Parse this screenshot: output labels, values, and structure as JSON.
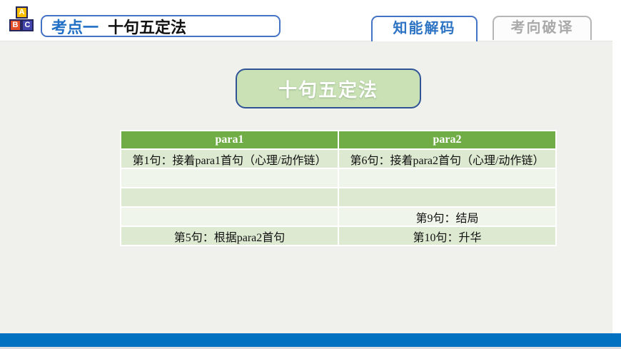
{
  "header": {
    "logo": {
      "blocks": [
        {
          "letter": "A",
          "color": "#ffc000"
        },
        {
          "letter": "B",
          "color": "#e44d26"
        },
        {
          "letter": "C",
          "color": "#4345ac"
        }
      ]
    },
    "badge": {
      "prefix": "考点一",
      "title": "十句五定法"
    },
    "tabs": [
      {
        "label": "知能解码",
        "active": true
      },
      {
        "label": "考向破译",
        "active": false
      }
    ]
  },
  "main": {
    "flow_button": "十句五定法",
    "table": {
      "columns": [
        "para1",
        "para2"
      ],
      "rows": [
        [
          "第1句：接着para1首句（心理/动作链）",
          "第6句：接着para2首句（心理/动作链）"
        ],
        [
          "",
          ""
        ],
        [
          "",
          ""
        ],
        [
          "",
          "第9句：结局"
        ],
        [
          "第5句：根据para2首句",
          "第10句：升华"
        ]
      ]
    }
  },
  "colors": {
    "accent_blue_text": "#2e74c4",
    "badge_border_blue": "#4472c4",
    "inactive_tab_gray": "#a9a9a9",
    "table_header_green": "#70ad47",
    "row_band_green": "#dde9d1",
    "row_band_light": "#eff5ea",
    "flow_node_fill": "#c9e1b5",
    "flow_node_border": "#2f5597",
    "bottom_bar_blue": "#0070c0",
    "body_panel_gray": "#f0f0ed"
  }
}
